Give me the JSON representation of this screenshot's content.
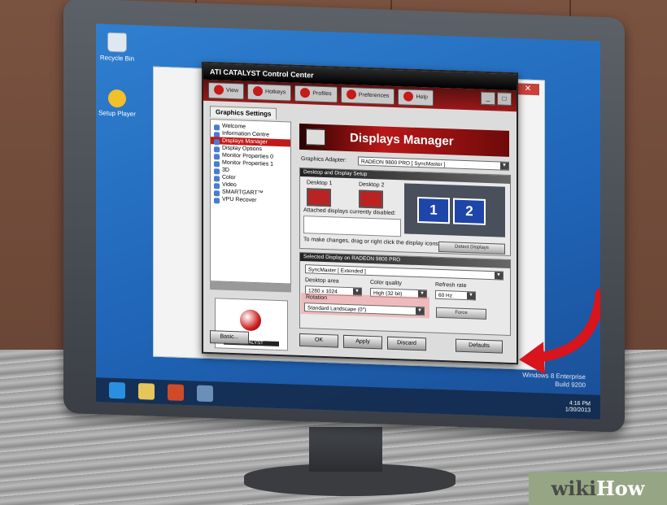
{
  "desktop": {
    "icons": [
      {
        "name": "recycle-bin",
        "label": "Recycle Bin"
      },
      {
        "name": "setup",
        "label": "Setup Player"
      }
    ]
  },
  "explorer": {
    "close_label": "✕"
  },
  "ccc": {
    "title": "ATI CATALYST Control Center",
    "toolbar": [
      "View",
      "Hotkeys",
      "Profiles",
      "Preferences",
      "Help"
    ],
    "window_buttons": [
      "_",
      "□"
    ],
    "tab": "Graphics Settings",
    "tree": [
      "Welcome",
      "Information Centre",
      "Displays Manager",
      "Display Options",
      "Monitor Properties 0",
      "Monitor Properties 1",
      "3D",
      "Color",
      "Video",
      "SMARTGART™",
      "VPU Recover"
    ],
    "selected_tree_index": 2,
    "logo_text": "CATALYST",
    "banner": "Displays Manager",
    "adapter_label": "Graphics Adapter:",
    "adapter_value": "RADEON 9800 PRO [ SyncMaster ]",
    "desktop_group_title": "Desktop and Display Setup",
    "desktop1": "Desktop 1",
    "desktop2": "Desktop 2",
    "attached_label": "Attached displays currently disabled:",
    "change_hint": "To make changes, drag or right click the display icons.",
    "detect_btn": "Detect Displays",
    "monitors": [
      "1",
      "2"
    ],
    "selected_group_title": "Selected Display on RADEON 9800 PRO",
    "display_name": "SyncMaster [ Extended ]",
    "area_label": "Desktop area",
    "area_value": "1280 x 1024",
    "quality_label": "Color quality",
    "quality_value": "High (32 bit)",
    "refresh_label": "Refresh rate",
    "refresh_value": "60 Hz",
    "rotation_label": "Rotation",
    "rotation_value": "Standard Landscape (0°)",
    "force_btn": "Force",
    "bottom_buttons": [
      "Basic...",
      "OK",
      "Apply",
      "Discard",
      "Defaults"
    ]
  },
  "watermark": [
    "Windows 8 Enterprise",
    "Build 9200"
  ],
  "tray": {
    "time": "4:16 PM",
    "date": "1/30/2013"
  },
  "brand": {
    "wiki": "wiki",
    "how": "How"
  }
}
